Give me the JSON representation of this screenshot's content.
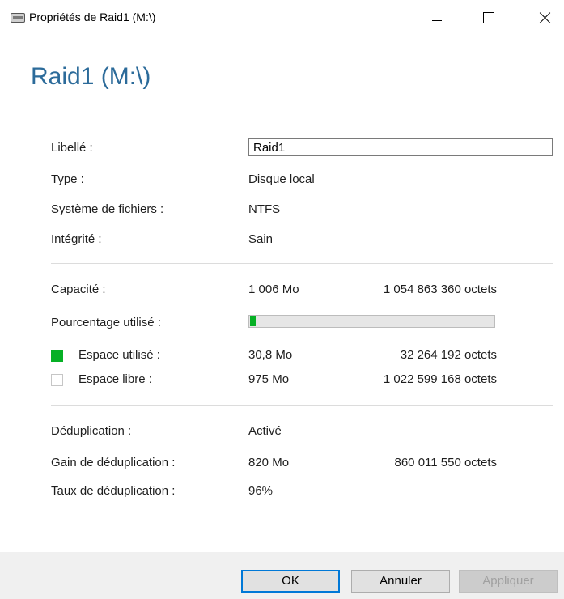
{
  "window": {
    "title": "Propriétés de Raid1 (M:\\)",
    "icon": "drive-icon"
  },
  "heading": "Raid1 (M:\\)",
  "general": {
    "label_label": "Libellé :",
    "label_value": "Raid1",
    "type_label": "Type :",
    "type_value": "Disque local",
    "fs_label": "Système de fichiers :",
    "fs_value": "NTFS",
    "integrity_label": "Intégrité :",
    "integrity_value": "Sain"
  },
  "capacity": {
    "label": "Capacité :",
    "size": "1 006 Mo",
    "bytes": "1 054 863 360 octets",
    "percent_label": "Pourcentage utilisé :",
    "percent_used": 0.03,
    "used_label": "Espace utilisé :",
    "used_size": "30,8 Mo",
    "used_bytes": "32 264 192 octets",
    "free_label": "Espace libre :",
    "free_size": "975 Mo",
    "free_bytes": "1 022 599 168 octets",
    "used_color": "#06b025",
    "free_color": "#ffffff"
  },
  "dedup": {
    "label": "Déduplication :",
    "value": "Activé",
    "gain_label": "Gain de déduplication :",
    "gain_size": "820 Mo",
    "gain_bytes": "860 011 550 octets",
    "rate_label": "Taux de déduplication :",
    "rate_value": "96%"
  },
  "buttons": {
    "ok": "OK",
    "cancel": "Annuler",
    "apply": "Appliquer"
  },
  "colors": {
    "heading": "#2c6b9a",
    "accent": "#0078d7"
  }
}
